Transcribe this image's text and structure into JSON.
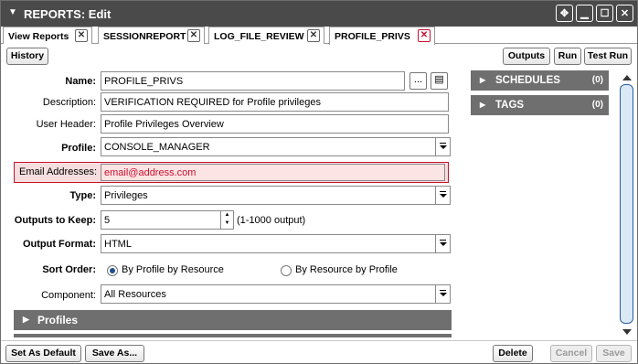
{
  "window": {
    "title": "REPORTS: Edit",
    "controls": [
      "move-icon",
      "minimize-icon",
      "maximize-icon",
      "close-icon"
    ]
  },
  "tabs": [
    {
      "label": "View Reports",
      "active": false
    },
    {
      "label": "SESSIONREPORT",
      "active": false
    },
    {
      "label": "LOG_FILE_REVIEW",
      "active": false
    },
    {
      "label": "PROFILE_PRIVS",
      "active": true
    }
  ],
  "toolbar": {
    "history": "History",
    "outputs": "Outputs",
    "run": "Run",
    "test_run": "Test Run"
  },
  "form": {
    "name_label": "Name:",
    "name_value": "PROFILE_PRIVS",
    "browse_btn": "...",
    "description_label": "Description:",
    "description_value": "VERIFICATION REQUIRED for Profile privileges",
    "user_header_label": "User Header:",
    "user_header_value": "Profile Privileges Overview",
    "profile_label": "Profile:",
    "profile_value": "CONSOLE_MANAGER",
    "email_label": "Email Addresses:",
    "email_placeholder": "email@address.com",
    "type_label": "Type:",
    "type_value": "Privileges",
    "outputs_label": "Outputs to Keep:",
    "outputs_value": "5",
    "outputs_hint": "(1-1000 output)",
    "format_label": "Output Format:",
    "format_value": "HTML",
    "sort_label": "Sort Order:",
    "sort_option1": "By Profile by Resource",
    "sort_option2": "By Resource by Profile",
    "sort_selected": "By Profile by Resource",
    "component_label": "Component:",
    "component_value": "All Resources"
  },
  "sections": {
    "profiles": "Profiles"
  },
  "side": {
    "schedules_label": "SCHEDULES",
    "schedules_count": "(0)",
    "tags_label": "TAGS",
    "tags_count": "(0)"
  },
  "footer": {
    "set_default": "Set As Default",
    "save_as": "Save As...",
    "delete": "Delete",
    "cancel": "Cancel",
    "save": "Save"
  },
  "colors": {
    "titlebar": "#4a4a4a",
    "section": "#6f6f6f",
    "error": "#c8102e",
    "error_bg": "#f7dede"
  }
}
